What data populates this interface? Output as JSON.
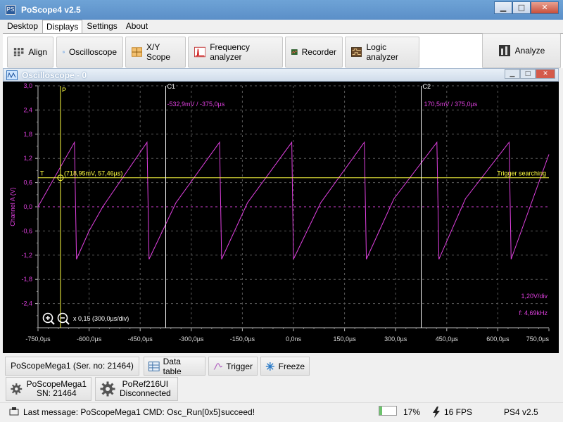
{
  "window": {
    "title": "PoScope4 v2.5",
    "app_icon": "PS",
    "minimize_glyph": "▁",
    "maximize_glyph": "□",
    "close_glyph": "✕"
  },
  "menu": [
    "Desktop",
    "Displays",
    "Settings",
    "About"
  ],
  "menu_active": "Displays",
  "ribbon": {
    "align": "Align",
    "oscilloscope": "Oscilloscope",
    "xy_scope": "X/Y Scope",
    "frequency_analyzer": "Frequency analyzer",
    "recorder": "Recorder",
    "logic_analyzer": "Logic analyzer",
    "analyze": "Analyze"
  },
  "scope_window": {
    "title": "Oscilloscope - 0"
  },
  "plot": {
    "ylabel": "Channel A (V)",
    "y_ticks": [
      "3,0",
      "2,4",
      "1,8",
      "1,2",
      "0,6",
      "0,0",
      "-0,6",
      "-1,2",
      "-1,8",
      "-2,4"
    ],
    "y_tick_values": [
      3.0,
      2.4,
      1.8,
      1.2,
      0.6,
      0.0,
      -0.6,
      -1.2,
      -1.8,
      -2.4
    ],
    "x_ticks": [
      "-750,0µs",
      "-600,0µs",
      "-450,0µs",
      "-300,0µs",
      "-150,0µs",
      "0,0ns",
      "150,0µs",
      "300,0µs",
      "450,0µs",
      "600,0µs",
      "750,0µs"
    ],
    "x_tick_values": [
      -750,
      -600,
      -450,
      -300,
      -150,
      0,
      150,
      300,
      450,
      600,
      750
    ],
    "x_range": [
      -750,
      750
    ],
    "y_range": [
      -3.0,
      3.0
    ],
    "marker_p_label": "P",
    "marker_p_time": -684,
    "cursor1_label": "C1",
    "cursor1_time": -375,
    "cursor1_readout": "-532,9mV / -375,0µs",
    "cursor2_label": "C2",
    "cursor2_time": 375,
    "cursor2_readout": "170,5mV / 375,0µs",
    "trigger_label": "T",
    "trigger_level": 0.72,
    "trigger_point_readout": "(718,95mV, 57,46µs)",
    "trigger_status": "Trigger searching",
    "vdiv": "1,20V/div",
    "frequency": "f: 4,69kHz",
    "zoom": "x 0,15 (300,0µs/div)",
    "colors": {
      "signal": "#e040e0",
      "trigger": "#ffff40",
      "cursor": "#ffffff",
      "grid": "#5a5a5a",
      "zero": "#d040d0"
    }
  },
  "chart_data": {
    "type": "line",
    "title": "",
    "xlabel": "",
    "ylabel": "Channel A (V)",
    "xlim": [
      -750,
      750
    ],
    "ylim": [
      -3.0,
      3.0
    ],
    "series": [
      {
        "name": "Channel A",
        "waveform": "sawtooth",
        "frequency_hz": 4690,
        "peak_v": 1.6,
        "trough_v": -1.3,
        "x": [
          -750,
          -643,
          -637,
          -600,
          -560,
          -430,
          -424,
          -345,
          -217,
          -211,
          -135,
          -5,
          0,
          80,
          208,
          214,
          295,
          421,
          427,
          505,
          633,
          639,
          750
        ],
        "y": [
          0.0,
          1.6,
          -1.3,
          -0.6,
          0.0,
          1.6,
          -1.3,
          0.1,
          1.6,
          -1.3,
          0.1,
          1.6,
          -1.3,
          0.1,
          1.6,
          -1.3,
          0.2,
          1.6,
          -1.3,
          0.2,
          1.6,
          -1.3,
          1.3
        ]
      }
    ]
  },
  "bottom": {
    "device": "PoScopeMega1 (Ser. no: 21464)",
    "data_table": "Data table",
    "trigger": "Trigger",
    "freeze": "Freeze",
    "dev1_line1": "PoScopeMega1",
    "dev1_line2": "SN: 21464",
    "dev2_line1": "PoRef216UI",
    "dev2_line2": "Disconnected"
  },
  "status": {
    "message": "Last message: PoScopeMega1 CMD: Osc_Run[0x5]",
    "result": "succeed!",
    "battery": "17%",
    "battery_level": 0.17,
    "fps": "16 FPS",
    "version": "PS4 v2.5"
  }
}
